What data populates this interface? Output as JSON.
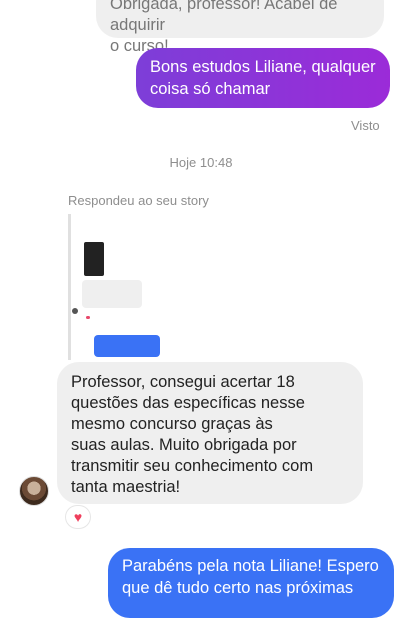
{
  "messages": {
    "top_incoming_line1": "Obrigada, professor! Acabei de adquirir",
    "top_incoming_line2": "o curso!",
    "outgoing_1_line1": "Bons estudos Liliane, qualquer",
    "outgoing_1_line2": "coisa só chamar",
    "seen_label": "Visto",
    "timestamp": "Hoje 10:48",
    "story_reply_label": "Respondeu ao seu story",
    "incoming_main_lines": [
      "Professor, consegui acertar 18",
      "questões das específicas nesse",
      "mesmo concurso graças às",
      "suas aulas. Muito obrigada por",
      "transmitir seu conhecimento com",
      "tanta maestria!"
    ],
    "reaction": "♥",
    "outgoing_2_lines": [
      "Parabéns pela nota Liliane! Espero",
      "que dê tudo certo nas próximas"
    ]
  },
  "colors": {
    "bubble_purple": "#8a2be2",
    "bubble_blue": "#3a72f5",
    "incoming_bg": "#efefef",
    "heart": "#ef3e5c"
  }
}
